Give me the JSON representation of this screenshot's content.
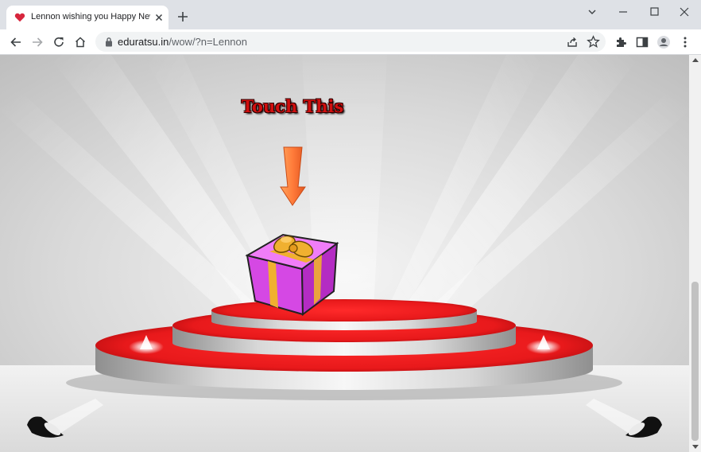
{
  "tab": {
    "title": "Lennon wishing you Happy New",
    "favicon": "heart-icon"
  },
  "toolbar": {
    "url_host": "eduratsu.in",
    "url_path": "/wow/?n=Lennon"
  },
  "page": {
    "prompt_text": "Touch This",
    "prompt_color": "#d10f0f",
    "arrow_color": "#ff7b3a",
    "gift_color": "#e45cf0",
    "ribbon_color": "#f0b030",
    "stage_red": "#e8191b"
  }
}
